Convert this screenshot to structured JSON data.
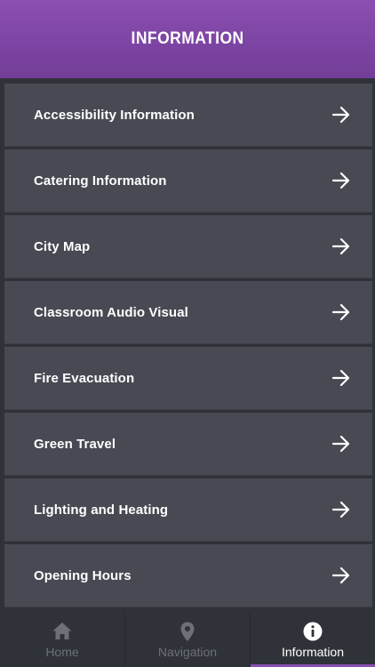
{
  "header": {
    "title": "INFORMATION"
  },
  "list": {
    "items": [
      {
        "label": "Accessibility Information"
      },
      {
        "label": "Catering Information"
      },
      {
        "label": "City Map"
      },
      {
        "label": "Classroom Audio Visual"
      },
      {
        "label": "Fire Evacuation"
      },
      {
        "label": "Green Travel"
      },
      {
        "label": "Lighting and Heating"
      },
      {
        "label": "Opening Hours"
      }
    ],
    "arrow_icon": "arrow-right-icon"
  },
  "tabbar": {
    "tabs": [
      {
        "label": "Home",
        "icon": "home-icon",
        "active": false
      },
      {
        "label": "Navigation",
        "icon": "map-pin-icon",
        "active": false
      },
      {
        "label": "Information",
        "icon": "info-icon",
        "active": true
      }
    ]
  },
  "colors": {
    "accent": "#8b4fb0",
    "row_bg": "#474a52",
    "background": "#2f3239",
    "inactive_tab": "#6d7078"
  }
}
